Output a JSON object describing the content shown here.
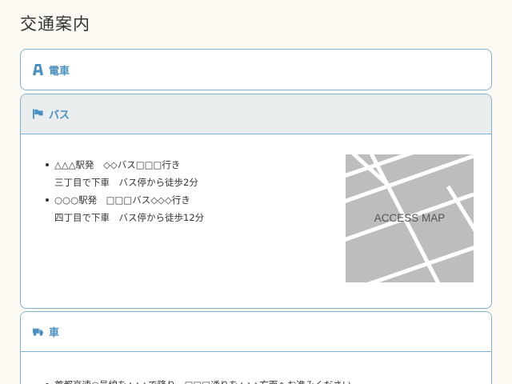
{
  "page": {
    "title": "交通案内"
  },
  "panels": {
    "train": {
      "label": "電車",
      "icon": "train-icon"
    },
    "bus": {
      "label": "バス",
      "icon": "flag-icon",
      "routes": [
        {
          "line1": "△△△駅発　◇◇バス□□□行き",
          "line2": "三丁目で下車　バス停から徒歩2分"
        },
        {
          "line1": "○○○駅発　□□□バス◇◇◇行き",
          "line2": "四丁目で下車　バス停から徒歩12分"
        }
      ],
      "map_label": "ACCESS MAP"
    },
    "car": {
      "label": "車",
      "icon": "truck-icon",
      "items": [
        "首都高速○号線を△△△で降り、□□□通りを△△△方面へお進みください。"
      ]
    }
  },
  "colors": {
    "accent": "#4a90c0",
    "border": "#7fb3d5",
    "header_open_bg": "#eaedee",
    "page_bg": "#fcf9f2",
    "map_bg": "#bdbdbd"
  }
}
